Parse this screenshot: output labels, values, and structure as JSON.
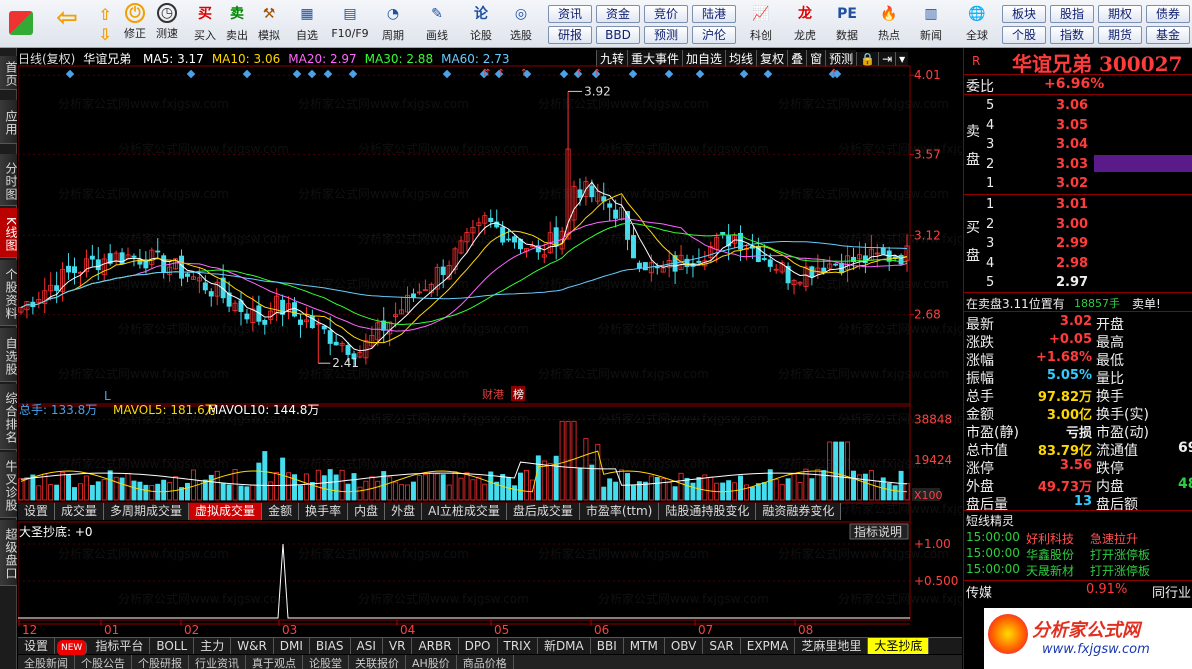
{
  "toolbar": {
    "buttons": [
      "修正",
      "测速",
      "买入",
      "卖出",
      "模拟",
      "自选",
      "F10/F9",
      "周期",
      "画线",
      "论股",
      "选股"
    ],
    "panel_row1": [
      "资讯",
      "资金",
      "竞价",
      "陆港"
    ],
    "panel_row2": [
      "研报",
      "BBD",
      "预测",
      "沪伦"
    ],
    "more": [
      "科创",
      "龙虎",
      "数据",
      "热点",
      "新闻",
      "全球"
    ],
    "right_row1": [
      "板块",
      "股指",
      "期权",
      "债券"
    ],
    "right_row2": [
      "个股",
      "指数",
      "期货",
      "基金"
    ]
  },
  "left_tabs": [
    "首页",
    "应用",
    "分时图",
    "K线图",
    "个股资料",
    "自选股",
    "综合排名",
    "牛叉诊股",
    "超级盘口"
  ],
  "chart": {
    "period": "日线(复权)",
    "stock": "华谊兄弟",
    "ma": [
      {
        "label": "MA5: 3.17",
        "color": "#ffffff"
      },
      {
        "label": "MA10: 3.06",
        "color": "#ffd700"
      },
      {
        "label": "MA20: 2.97",
        "color": "#ff66ff"
      },
      {
        "label": "MA30: 2.88",
        "color": "#33ff33"
      },
      {
        "label": "MA60: 2.73",
        "color": "#66ccff"
      }
    ],
    "top_menu": [
      "九转",
      "重大事件",
      "加自选",
      "均线",
      "复权",
      "叠",
      "窗",
      "预测"
    ],
    "price_axis": [
      "4.01",
      "3.57",
      "3.12",
      "2.68"
    ],
    "high_label": "3.92",
    "low_label": "2.41",
    "marker_L": "L",
    "marker_1": "财港",
    "marker_2": "榜",
    "x_labels": [
      "12",
      "01",
      "02",
      "03",
      "04",
      "05",
      "06",
      "07",
      "08"
    ],
    "vol_label": "总手: 133.8万",
    "mavol5": "MAVOL5: 181.6万",
    "mavol10": "MAVOL10: 144.8万",
    "vol_axis": [
      "38848",
      "19424"
    ],
    "vol_unit": "X100",
    "sub_tabs": [
      "设置",
      "成交量",
      "多周期成交量",
      "虚拟成交量",
      "金额",
      "换手率",
      "内盘",
      "外盘",
      "AI立桩成交量",
      "盘后成交量",
      "市盈率(ttm)",
      "陆股通持股变化",
      "融资融券变化"
    ],
    "ind_label": "大圣抄底: +0",
    "ind_btn": "指标说明",
    "ind_axis": [
      "+1.00",
      "+0.500"
    ],
    "bottom_tabs": [
      "设置",
      "NEW",
      "指标平台",
      "BOLL",
      "主力",
      "W&R",
      "DMI",
      "BIAS",
      "ASI",
      "VR",
      "ARBR",
      "DPO",
      "TRIX",
      "新DMA",
      "BBI",
      "MTM",
      "OBV",
      "SAR",
      "EXPMA",
      "芝麻里地里",
      "大圣抄底"
    ],
    "bottom2": [
      "全股新闻",
      "个股公告",
      "个股研报",
      "行业资讯",
      "真于观点",
      "论股堂",
      "关联报价",
      "AH股价",
      "商品价格"
    ],
    "chart_data": {
      "type": "candlestick",
      "ylim": [
        2.3,
        4.05
      ],
      "high": 3.92,
      "low": 2.41
    }
  },
  "quote": {
    "code": "R",
    "title": "华谊兄弟 300027",
    "weibi_label": "委比",
    "weibi": "+6.96%",
    "sell_label": "卖盘",
    "buy_label": "买盘",
    "sells": [
      {
        "n": "5",
        "p": "3.06"
      },
      {
        "n": "4",
        "p": "3.05"
      },
      {
        "n": "3",
        "p": "3.04"
      },
      {
        "n": "2",
        "p": "3.03"
      },
      {
        "n": "1",
        "p": "3.02"
      }
    ],
    "buys": [
      {
        "n": "1",
        "p": "3.01"
      },
      {
        "n": "2",
        "p": "3.00"
      },
      {
        "n": "3",
        "p": "2.99"
      },
      {
        "n": "4",
        "p": "2.98"
      },
      {
        "n": "5",
        "p": "2.97"
      }
    ],
    "notice": "在卖盘3.11位置有",
    "notice_vol": "18857手",
    "notice_tag": "卖单!",
    "stats": [
      {
        "l": "最新",
        "v": "3.02",
        "c": "red",
        "l2": "开盘"
      },
      {
        "l": "涨跌",
        "v": "+0.05",
        "c": "red",
        "l2": "最高"
      },
      {
        "l": "涨幅",
        "v": "+1.68%",
        "c": "red",
        "l2": "最低"
      },
      {
        "l": "振幅",
        "v": "5.05%",
        "c": "cyan",
        "l2": "量比"
      },
      {
        "l": "总手",
        "v": "97.82万",
        "c": "yellow",
        "l2": "换手"
      },
      {
        "l": "金额",
        "v": "3.00亿",
        "c": "yellow",
        "l2": "换手(实)"
      },
      {
        "l": "市盈(静)",
        "v": "亏损",
        "c": "white",
        "l2": "市盈(动)"
      },
      {
        "l": "总市值",
        "v": "83.79亿",
        "c": "yellow",
        "l2": "流通值"
      },
      {
        "l": "涨停",
        "v": "3.56",
        "c": "red",
        "l2": "跌停"
      },
      {
        "l": "外盘",
        "v": "49.73万",
        "c": "red",
        "l2": "内盘"
      },
      {
        "l": "盘后量",
        "v": "13",
        "c": "cyan",
        "l2": "盘后额"
      }
    ],
    "partial_right": [
      "69",
      "48"
    ],
    "fast_title": "短线精灵",
    "fast": [
      {
        "t": "15:00:00",
        "s": "好利科技",
        "e": "急速拉升"
      },
      {
        "t": "15:00:00",
        "s": "华鑫股份",
        "e": "打开涨停板"
      },
      {
        "t": "15:00:00",
        "s": "天晟新材",
        "e": "打开涨停板"
      }
    ],
    "media_label": "传媒",
    "media_val": "0.91%",
    "media_right": "同行业",
    "logo": "分析家公式网",
    "logo_url": "www.fxjgsw.com"
  }
}
